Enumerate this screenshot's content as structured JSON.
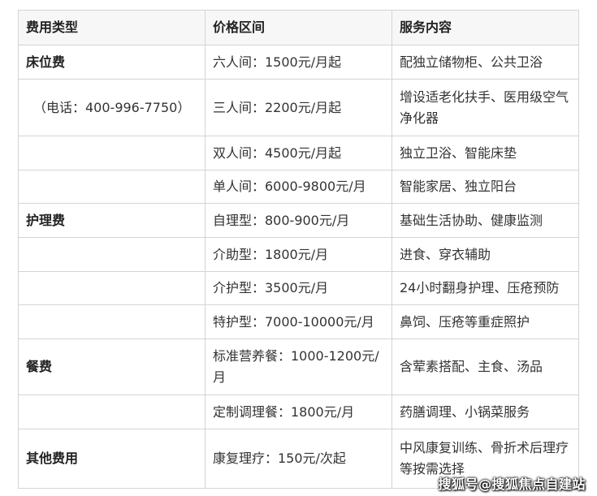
{
  "headers": [
    "费用类型",
    "价格区间",
    "服务内容"
  ],
  "rows": [
    [
      "床位费",
      "六人间：1500元/月起",
      "配独立储物柜、公共卫浴"
    ],
    [
      "（电话：400-996-7750）",
      "三人间：2200元/月起",
      "增设适老化扶手、医用级空气净化器"
    ],
    [
      "",
      "双人间：4500元/月起",
      "独立卫浴、智能床垫"
    ],
    [
      "",
      "单人间：6000-9800元/月",
      "智能家居、独立阳台"
    ],
    [
      "护理费",
      "自理型：800-900元/月",
      "基础生活协助、健康监测"
    ],
    [
      "",
      "介助型：1800元/月",
      "进食、穿衣辅助"
    ],
    [
      "",
      "介护型：3500元/月",
      "24小时翻身护理、压疮预防"
    ],
    [
      "",
      "特护型：7000-10000元/月",
      "鼻饲、压疮等重症照护"
    ],
    [
      "餐费",
      "标准营养餐：1000-1200元/月",
      "含荤素搭配、主食、汤品"
    ],
    [
      "",
      "定制调理餐：1800元/月",
      "药膳调理、小锅菜服务"
    ],
    [
      "其他费用",
      "康复理疗：150元/次起",
      "中风康复训练、骨折术后理疗等按需选择"
    ]
  ],
  "watermark": "搜狐号@搜狐焦点自建站"
}
